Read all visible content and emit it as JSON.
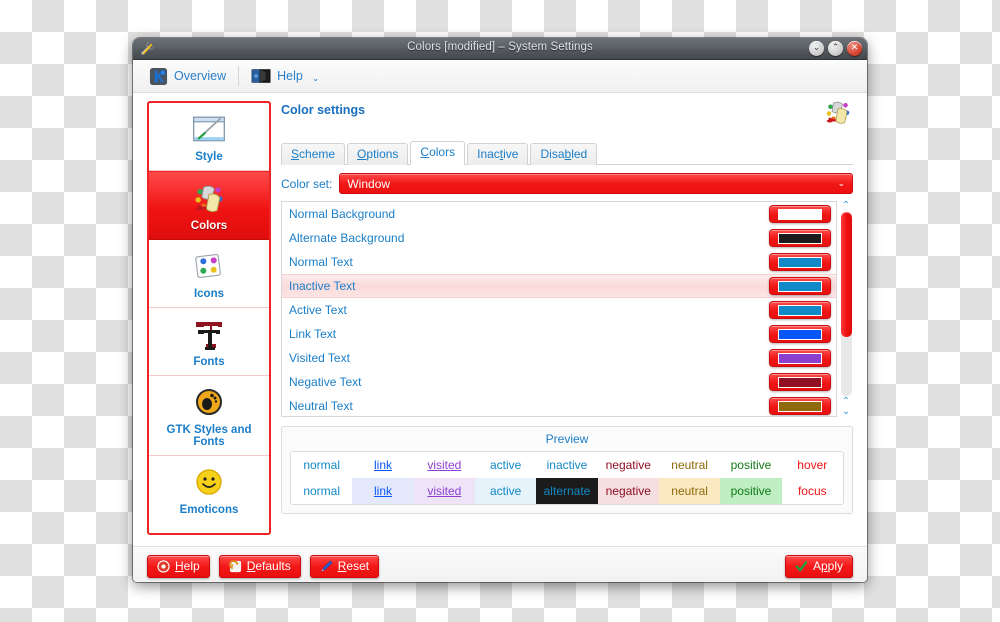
{
  "window": {
    "title": "Colors [modified] – System Settings",
    "icon": "tools-icon",
    "controls": [
      {
        "name": "minimize-button",
        "glyph": "⌄"
      },
      {
        "name": "maximize-button",
        "glyph": "⌃"
      },
      {
        "name": "close-button",
        "glyph": "✕"
      }
    ]
  },
  "toolbar": {
    "overview_label": "Overview",
    "help_label": "Help",
    "chevron": "⌄"
  },
  "sidebar": {
    "items": [
      {
        "label": "Style",
        "icon": "style-icon",
        "selected": false
      },
      {
        "label": "Colors",
        "icon": "colors-icon",
        "selected": true
      },
      {
        "label": "Icons",
        "icon": "icons-icon",
        "selected": false
      },
      {
        "label": "Fonts",
        "icon": "fonts-icon",
        "selected": false
      },
      {
        "label": "GTK Styles and Fonts",
        "icon": "gtk-icon",
        "selected": false
      },
      {
        "label": "Emoticons",
        "icon": "emoticons-icon",
        "selected": false
      }
    ]
  },
  "main": {
    "page_title": "Color settings",
    "header_icon": "colors-icon",
    "tabs": [
      {
        "label": "Scheme",
        "accel": "S",
        "active": false
      },
      {
        "label": "Options",
        "accel": "O",
        "active": false
      },
      {
        "label": "Colors",
        "accel": "C",
        "active": true
      },
      {
        "label": "Inactive",
        "accel": "t",
        "active": false
      },
      {
        "label": "Disabled",
        "accel": "b",
        "active": false
      }
    ],
    "color_set": {
      "label": "Color set:",
      "value": "Window",
      "chevron": "⌄",
      "accent": "#f31818"
    },
    "color_rows": [
      {
        "name": "Normal Background",
        "color": "#ffffff",
        "hover": false
      },
      {
        "name": "Alternate Background",
        "color": "#1b1b1b",
        "hover": false
      },
      {
        "name": "Normal Text",
        "color": "#1189c6",
        "hover": false
      },
      {
        "name": "Inactive Text",
        "color": "#1189c6",
        "hover": true
      },
      {
        "name": "Active Text",
        "color": "#1189c6",
        "hover": false
      },
      {
        "name": "Link Text",
        "color": "#0a55f7",
        "hover": false
      },
      {
        "name": "Visited Text",
        "color": "#8c3fd0",
        "hover": false
      },
      {
        "name": "Negative Text",
        "color": "#8f0f23",
        "hover": false
      },
      {
        "name": "Neutral Text",
        "color": "#8e6a0a",
        "hover": false
      }
    ],
    "scrollbar": {
      "up_arrow": "⌃",
      "down_arrow": "⌄",
      "thumb_percent": 68
    },
    "preview": {
      "title": "Preview",
      "row1": [
        {
          "label": "normal",
          "fg": "#1189c6",
          "bg": "#ffffff",
          "deco": "none"
        },
        {
          "label": "link",
          "fg": "#0a55f7",
          "bg": "#ffffff",
          "deco": "underline"
        },
        {
          "label": "visited",
          "fg": "#8c3fd0",
          "bg": "#ffffff",
          "deco": "underline"
        },
        {
          "label": "active",
          "fg": "#1189c6",
          "bg": "#ffffff",
          "deco": "none"
        },
        {
          "label": "inactive",
          "fg": "#1189c6",
          "bg": "#ffffff",
          "deco": "none"
        },
        {
          "label": "negative",
          "fg": "#8f0f23",
          "bg": "#ffffff",
          "deco": "none"
        },
        {
          "label": "neutral",
          "fg": "#8e6a0a",
          "bg": "#ffffff",
          "deco": "none"
        },
        {
          "label": "positive",
          "fg": "#127a18",
          "bg": "#ffffff",
          "deco": "none"
        },
        {
          "label": "hover",
          "fg": "#f01414",
          "bg": "#ffffff",
          "deco": "none"
        }
      ],
      "row2": [
        {
          "label": "normal",
          "fg": "#1189c6",
          "bg": "#ffffff",
          "deco": "none"
        },
        {
          "label": "link",
          "fg": "#0a55f7",
          "bg": "#e4e8fb",
          "deco": "underline"
        },
        {
          "label": "visited",
          "fg": "#8c3fd0",
          "bg": "#efe4f7",
          "deco": "underline"
        },
        {
          "label": "active",
          "fg": "#1189c6",
          "bg": "#e6f3fb",
          "deco": "none"
        },
        {
          "label": "alternate",
          "fg": "#1189c6",
          "bg": "#1b1b1b",
          "deco": "none"
        },
        {
          "label": "negative",
          "fg": "#8f0f23",
          "bg": "#f6dfe1",
          "deco": "none"
        },
        {
          "label": "neutral",
          "fg": "#8e6a0a",
          "bg": "#fbe9c4",
          "deco": "none"
        },
        {
          "label": "positive",
          "fg": "#127a18",
          "bg": "#bfeec2",
          "deco": "none"
        },
        {
          "label": "focus",
          "fg": "#f01414",
          "bg": "#ffffff",
          "deco": "none"
        }
      ]
    }
  },
  "footer": {
    "buttons": [
      {
        "label": "Help",
        "accel": "H",
        "icon": "lifebuoy-icon",
        "align": "left"
      },
      {
        "label": "Defaults",
        "accel": "D",
        "icon": "undo-icon",
        "align": "left"
      },
      {
        "label": "Reset",
        "accel": "R",
        "icon": "pencil-icon",
        "align": "left"
      },
      {
        "label": "Apply",
        "accel": "p",
        "icon": "check-icon",
        "align": "right"
      }
    ]
  }
}
